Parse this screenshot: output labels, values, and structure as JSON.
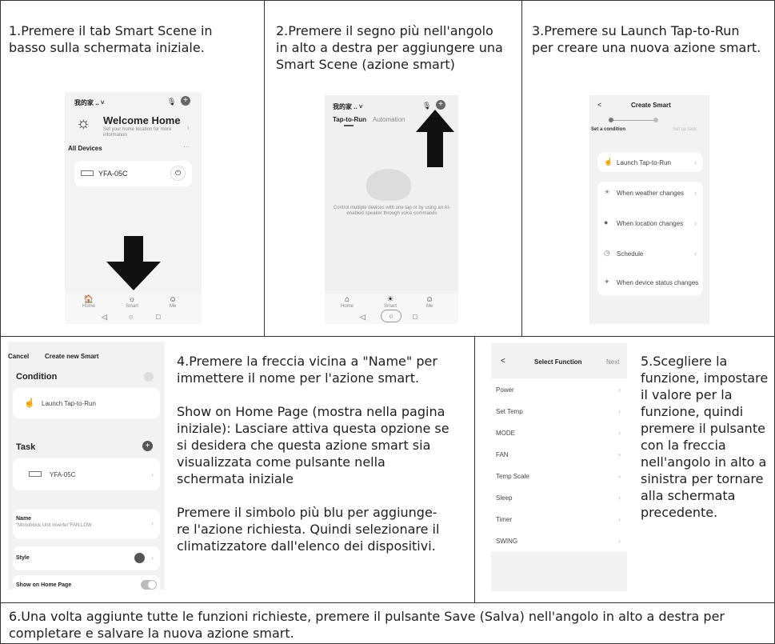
{
  "steps": {
    "step1": "1.Premere il tab Smart Scene in\nbasso sulla schermata iniziale.",
    "step2": "2.Premere il segno più nell'angolo\nin alto a destra per aggiungere una\nSmart Scene (azione smart)",
    "step3": "3.Premere su Launch Tap-to-Run\nper creare una nuova azione smart.",
    "step4": "4.Premere la freccia vicina a \"Name\" per\nimmettere il nome per l'azione smart.\n\nShow on Home Page (mostra nella pagina\niniziale): Lasciare attiva questa opzione se\nsi desidera che questa azione smart sia\nvisualizzata come pulsante nella\nschermata iniziale\n\nPremere il simbolo più blu per aggiunge-\nre l'azione richiesta. Quindi selezionare il\nclimatizzatore dall'elenco dei dispositivi.",
    "step5": "5.Scegliere la\nfunzione, impostare\nil valore per la\nfunzione, quindi\npremere il pulsante\ncon la freccia\nnell'angolo in alto a\nsinistra per tornare\nalla schermata\nprecedente.",
    "step6": "6.Una volta aggiunte tutte le funzioni richieste, premere il pulsante Save (Salva) nell'angolo in alto a destra per\ncompletare e salvare la nuova azione smart."
  },
  "screen1": {
    "home_name": "我的家 .. ˅",
    "welcome": "Welcome Home",
    "welcome_sub": "Set your home location for more information",
    "all_devices": "All Devices",
    "more": "···",
    "device": "YFA-05C",
    "nav": [
      "Home",
      "Smart",
      "Me"
    ]
  },
  "screen2": {
    "home_name": "我的家 .. ˅",
    "tab_active": "Tap-to-Run",
    "tab_other": "Automation",
    "empty_text": "Control multiple devices with one tap or by using an AI-enabled speaker through voice commands",
    "nav": [
      "Home",
      "Smart",
      "Me"
    ]
  },
  "screen3": {
    "back": "<",
    "title": "Create Smart",
    "set_condition": "Set a condition",
    "setup_task": "Set up task",
    "items": [
      "Launch Tap-to-Run",
      "When weather changes",
      "When location changes",
      "Schedule",
      "When device status changes"
    ]
  },
  "screen4": {
    "cancel": "Cancel",
    "title": "Create new Smart",
    "condition": "Condition",
    "launch": "Launch Tap-to-Run",
    "task": "Task",
    "device": "YFA-05C",
    "name_label": "Name",
    "name_value": "\"Monoblock Unit Inverter\"FAN:LOW",
    "style": "Style",
    "show_home": "Show on Home Page"
  },
  "screen5": {
    "back": "<",
    "title": "Select Function",
    "next": "Next",
    "items": [
      "Power",
      "Set Temp",
      "MODE",
      "FAN",
      "Temp Scale",
      "Sleep",
      "Timer",
      "SWING"
    ]
  },
  "colors": {
    "accent_red": "#d8453a",
    "border": "#333333",
    "phone_bg": "#f3f3f3"
  }
}
